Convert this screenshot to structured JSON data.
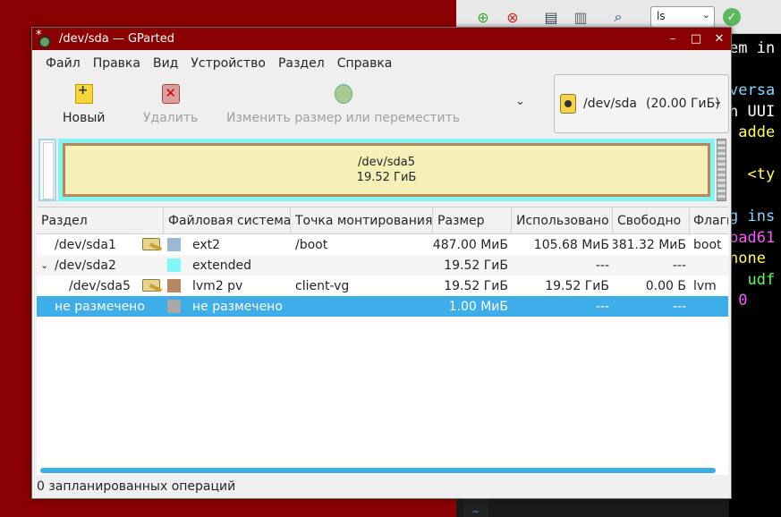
{
  "window": {
    "title": "/dev/sda — GParted",
    "minimize_glyph": "–",
    "maximize_glyph": "□",
    "close_glyph": "✕"
  },
  "menu": [
    "Файл",
    "Правка",
    "Вид",
    "Устройство",
    "Раздел",
    "Справка"
  ],
  "toolbar": {
    "new_label": "Новый",
    "delete_label": "Удалить",
    "resize_label": "Изменить размер или переместить",
    "overflow_glyph": "⌄"
  },
  "device_selector": {
    "device": "/dev/sda",
    "size": "(20.00 ГиБ)"
  },
  "disk_map": {
    "partition_name": "/dev/sda5",
    "partition_size": "19.52 ГиБ"
  },
  "table": {
    "columns": [
      "Раздел",
      "Файловая система",
      "Точка монтирования",
      "Размер",
      "Использовано",
      "Свободно",
      "Флаги"
    ],
    "rows": [
      {
        "partition": "/dev/sda1",
        "fs": "ext2",
        "fs_color": "#9db8d2",
        "mount": "/boot",
        "size": "487.00 МиБ",
        "used": "105.68 МиБ",
        "free": "381.32 МиБ",
        "flags": "boot"
      },
      {
        "partition": "/dev/sda2",
        "fs": "extended",
        "fs_color": "#7ef8f8",
        "mount": "",
        "size": "19.52 ГиБ",
        "used": "---",
        "free": "---",
        "flags": ""
      },
      {
        "partition": "/dev/sda5",
        "fs": "lvm2 pv",
        "fs_color": "#b5885f",
        "mount": "client-vg",
        "size": "19.52 ГиБ",
        "used": "19.52 ГиБ",
        "free": "0.00 Б",
        "flags": "lvm"
      },
      {
        "partition": "не размечено",
        "fs": "не размечено",
        "fs_color": "#a8a8a8",
        "mount": "",
        "size": "1.00 МиБ",
        "used": "---",
        "free": "---",
        "flags": ""
      }
    ]
  },
  "status": "0 запланированных операций",
  "background": {
    "combo_value": "ls",
    "terminal_lines": [
      "em in",
      "",
      "versa",
      "h UUI",
      " adde",
      "",
      "  <ty",
      "",
      "g ins",
      "bad61",
      "none",
      "  udf",
      " 0"
    ],
    "gutter_text": "~"
  }
}
